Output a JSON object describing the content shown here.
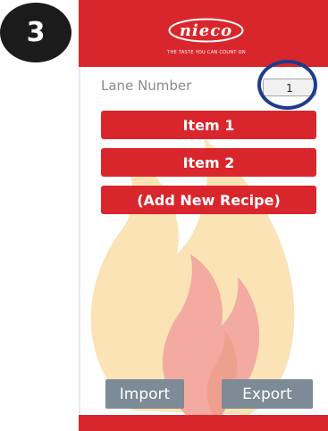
{
  "step_number": "3",
  "header": {
    "logo_text": "nieco",
    "tagline": "THE TASTE YOU CAN COUNT ON"
  },
  "lane": {
    "label": "Lane Number",
    "value": "1"
  },
  "recipes": [
    {
      "label": "Item 1"
    },
    {
      "label": "Item 2"
    },
    {
      "label": "(Add New Recipe)"
    }
  ],
  "footer": {
    "import_label": "Import",
    "export_label": "Export"
  },
  "colors": {
    "brand_red": "#d9262c",
    "highlight_blue": "#1f3b8c",
    "footer_button_gray": "#7c8b95"
  }
}
